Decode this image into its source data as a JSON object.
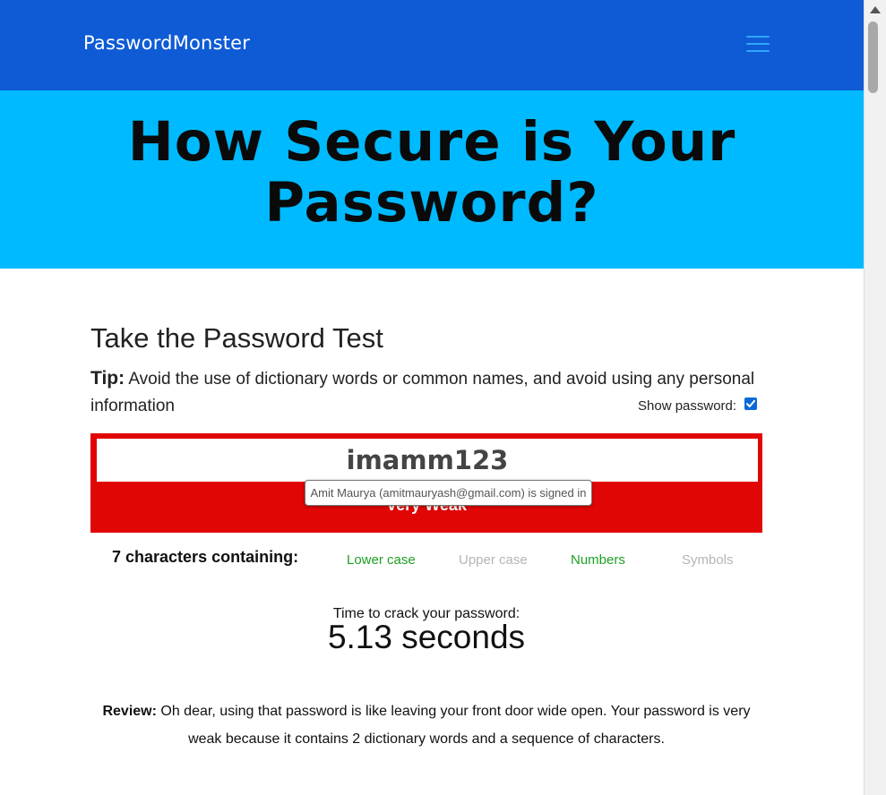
{
  "header": {
    "brand": "PasswordMonster",
    "menu_icon": "hamburger-menu-icon",
    "colors": {
      "navbar": "#0e5bd5",
      "hero": "#00baff"
    }
  },
  "hero": {
    "title": "How Secure is Your Password?"
  },
  "test": {
    "title": "Take the Password Test",
    "tip_label": "Tip:",
    "tip_text": " Avoid the use of dictionary words or common names, and avoid using any personal information",
    "show_password_label": "Show password:",
    "show_password_checked": true,
    "password_value": "imamm123",
    "strength_label": "Very Weak",
    "strength_color": "#e10606",
    "autofill_tooltip": "Amit Maurya (amitmauryash@gmail.com) is signed in"
  },
  "analysis": {
    "character_summary": "7 characters containing:",
    "types": [
      {
        "label": "Lower case",
        "present": true
      },
      {
        "label": "Upper case",
        "present": false
      },
      {
        "label": "Numbers",
        "present": true
      },
      {
        "label": "Symbols",
        "present": false
      }
    ],
    "crack_label": "Time to crack your password:",
    "crack_time": "5.13 seconds"
  },
  "review": {
    "label": "Review:",
    "text": " Oh dear, using that password is like leaving your front door wide open. Your password is very weak because it contains 2 dictionary words and a sequence of characters."
  }
}
